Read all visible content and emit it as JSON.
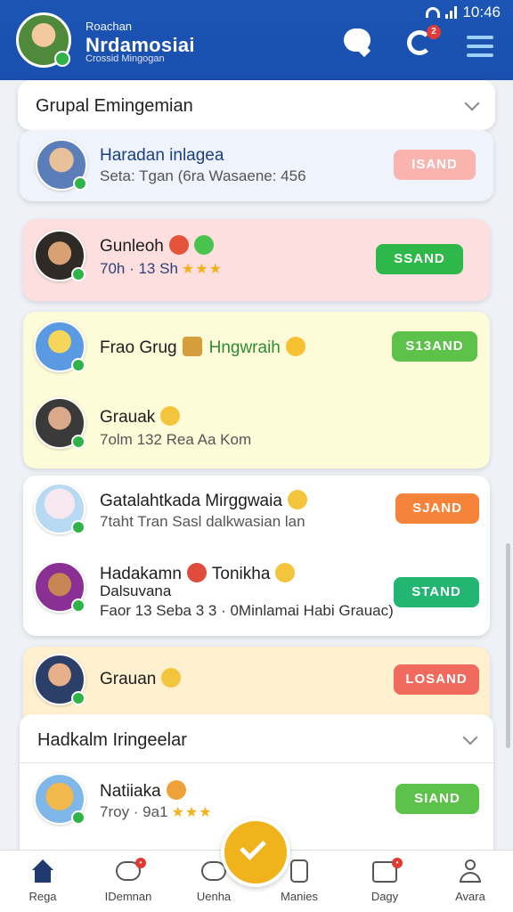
{
  "status_bar": {
    "time": "10:46"
  },
  "header": {
    "subtitle": "Roachan",
    "title": "Nrdamosiai",
    "tagline": "Crossid Mingogan",
    "sync_badge": "2"
  },
  "groups": [
    {
      "title": "Grupal Emingemian"
    },
    {
      "title": "Hadkalm Iringeelar"
    }
  ],
  "rows": [
    {
      "name": "Haradan inlagea",
      "sub": "Seta: Tgan (6ra Wasaene: 456",
      "button": "ISAND",
      "color": "#f9b4b0"
    },
    {
      "name": "Gunleoh",
      "sub": "70h · 13 Sh",
      "button": "SSAND",
      "color": "#2fb84a"
    },
    {
      "name": "Frao Grug",
      "name2": "Hngwraih",
      "sub": "",
      "button": "S13AND",
      "color": "#5cc24a"
    },
    {
      "name": "Grauak",
      "sub": "7olm 132 Rea Aa Kom",
      "button": "",
      "color": ""
    },
    {
      "name": "Gatalahtkada Mirggwaia",
      "sub": "7taht Tran Sasl dalkwasian lan",
      "button": "SJAND",
      "color": "#f5843a"
    },
    {
      "name": "Hadakamn",
      "name2": "Tonikha",
      "sub": "Dalsuvana",
      "sub2": "Faor 13 Seba 3 3 · 0Minlamai Habi Grauac)",
      "button": "STAND",
      "color": "#22b672"
    },
    {
      "name": "Grauan",
      "sub": "",
      "button": "LOSAND",
      "color": "#f06b5e"
    },
    {
      "name": "Natiiaka",
      "sub": "7roy · 9a1",
      "button": "SIAND",
      "color": "#5cc24a"
    }
  ],
  "nav": [
    {
      "label": "Rega"
    },
    {
      "label": "IDemnan",
      "badge": "•"
    },
    {
      "label": "Uenha"
    },
    {
      "label": "Manies"
    },
    {
      "label": "Dagy",
      "badge": "•"
    },
    {
      "label": "Avara"
    }
  ]
}
